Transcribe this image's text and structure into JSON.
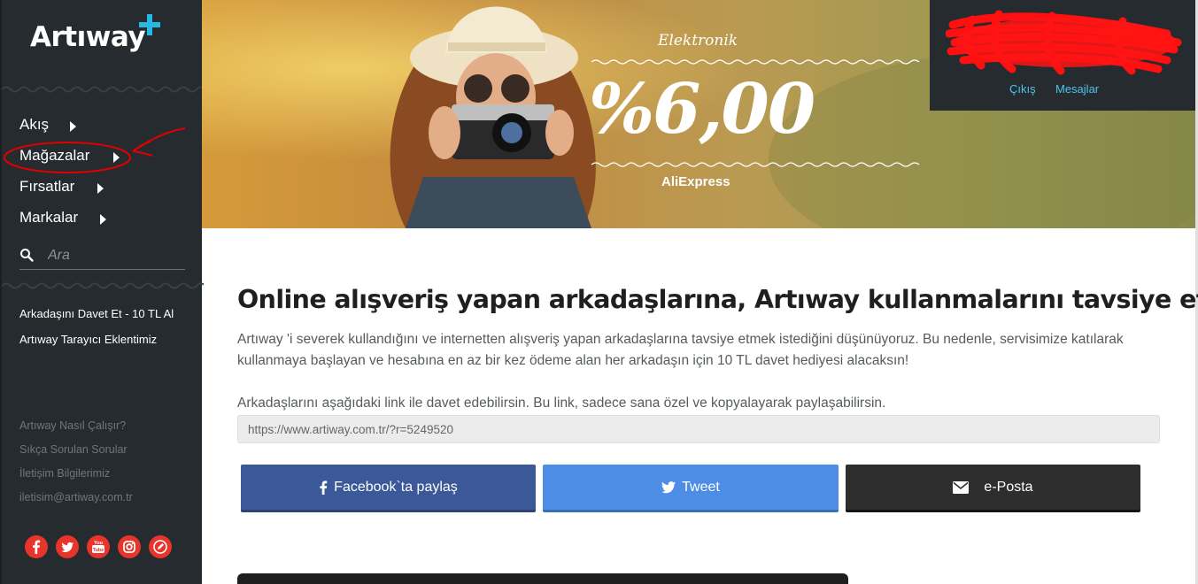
{
  "brand": {
    "name": "Artıway",
    "plus": "+"
  },
  "nav": [
    {
      "label": "Akış"
    },
    {
      "label": "Mağazalar"
    },
    {
      "label": "Fırsatlar"
    },
    {
      "label": "Markalar"
    }
  ],
  "search": {
    "placeholder": "Ara",
    "value": ""
  },
  "side_links": [
    "Arkadaşını Davet Et - 10 TL Al",
    "Artıway Tarayıcı Eklentimiz"
  ],
  "footer_links": [
    "Artıway Nasıl Çalışır?",
    "Sıkça Sorulan Sorular",
    "İletişim Bilgilerimiz",
    "iletisim@artiway.com.tr"
  ],
  "social": [
    "facebook-icon",
    "twitter-icon",
    "youtube-icon",
    "instagram-icon",
    "blog-icon"
  ],
  "hero": {
    "category": "Elektronik",
    "rate": "%6,00",
    "store": "AliExpress"
  },
  "user": {
    "logout": "Çıkış",
    "messages": "Mesajlar"
  },
  "main": {
    "title": "Online alışveriş yapan arkadaşlarına, Artıway kullanmalarını tavsiye et",
    "desc": "Artıway 'i severek kullandığını ve internetten alışveriş yapan arkadaşlarına tavsiye etmek istediğini düşünüyoruz. Bu nedenle, servisimize katılarak kullanmaya başlayan ve hesabına en az bir kez ödeme alan her arkadaşın için 10 TL davet hediyesi alacaksın!",
    "invite_text": "Arkadaşlarını aşağıdaki link ile davet edebilirsin. Bu link, sadece sana özel ve kopyalayarak paylaşabilirsin.",
    "invite_link": "https://www.artiway.com.tr/?r=5249520",
    "share": {
      "facebook": "Facebook`ta paylaş",
      "tweet": "Tweet",
      "email": "e-Posta"
    }
  },
  "colors": {
    "sidebar": "#252b2e",
    "accent": "#27b8e6",
    "social": "#e8342b",
    "facebook": "#3b5998",
    "twitter": "#4d8de6",
    "email": "#2e2e2e",
    "annotation": "#e00000"
  }
}
